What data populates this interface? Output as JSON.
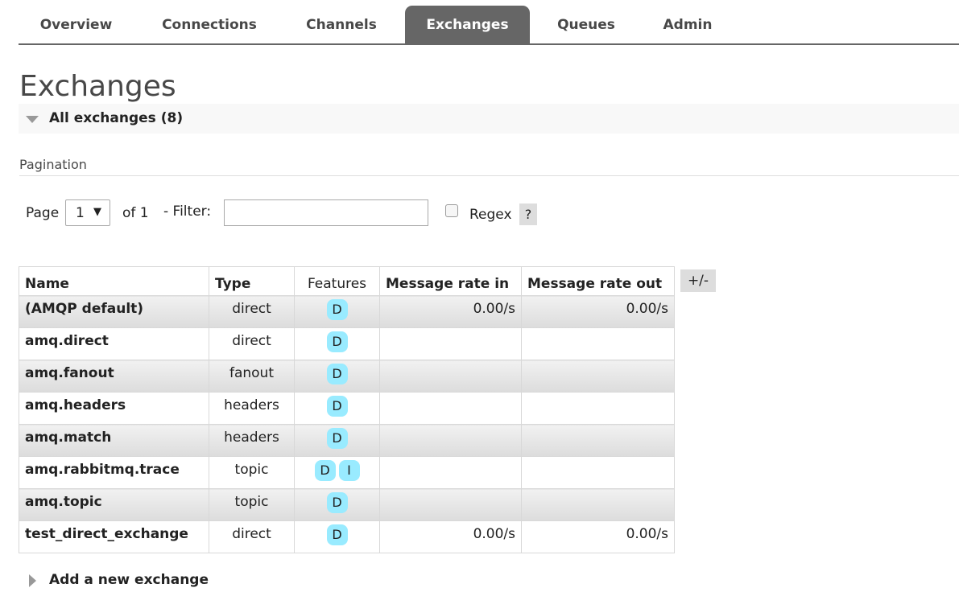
{
  "nav": {
    "tabs": [
      {
        "label": "Overview",
        "active": false
      },
      {
        "label": "Connections",
        "active": false
      },
      {
        "label": "Channels",
        "active": false
      },
      {
        "label": "Exchanges",
        "active": true
      },
      {
        "label": "Queues",
        "active": false
      },
      {
        "label": "Admin",
        "active": false
      }
    ]
  },
  "page_title": "Exchanges",
  "section": {
    "label": "All exchanges (8)",
    "icon": "triangle-down-icon"
  },
  "pagination": {
    "title": "Pagination",
    "page_label": "Page",
    "page_value": "1",
    "of_label": "of 1",
    "filter_label": "- Filter:",
    "filter_value": "",
    "regex_label": "Regex",
    "regex_checked": false,
    "help_label": "?"
  },
  "table": {
    "headers": {
      "name": "Name",
      "type": "Type",
      "features": "Features",
      "rate_in": "Message rate in",
      "rate_out": "Message rate out"
    },
    "columns_toggle": "+/-",
    "rows": [
      {
        "name": "(AMQP default)",
        "type": "direct",
        "features": [
          "D"
        ],
        "rate_in": "0.00/s",
        "rate_out": "0.00/s"
      },
      {
        "name": "amq.direct",
        "type": "direct",
        "features": [
          "D"
        ],
        "rate_in": "",
        "rate_out": ""
      },
      {
        "name": "amq.fanout",
        "type": "fanout",
        "features": [
          "D"
        ],
        "rate_in": "",
        "rate_out": ""
      },
      {
        "name": "amq.headers",
        "type": "headers",
        "features": [
          "D"
        ],
        "rate_in": "",
        "rate_out": ""
      },
      {
        "name": "amq.match",
        "type": "headers",
        "features": [
          "D"
        ],
        "rate_in": "",
        "rate_out": ""
      },
      {
        "name": "amq.rabbitmq.trace",
        "type": "topic",
        "features": [
          "D",
          "I"
        ],
        "rate_in": "",
        "rate_out": ""
      },
      {
        "name": "amq.topic",
        "type": "topic",
        "features": [
          "D"
        ],
        "rate_in": "",
        "rate_out": ""
      },
      {
        "name": "test_direct_exchange",
        "type": "direct",
        "features": [
          "D"
        ],
        "rate_in": "0.00/s",
        "rate_out": "0.00/s"
      }
    ]
  },
  "add_section": {
    "label": "Add a new exchange",
    "icon": "triangle-right-icon"
  },
  "colors": {
    "active_tab": "#666666",
    "badge": "#99ebff",
    "text": "#222222"
  }
}
